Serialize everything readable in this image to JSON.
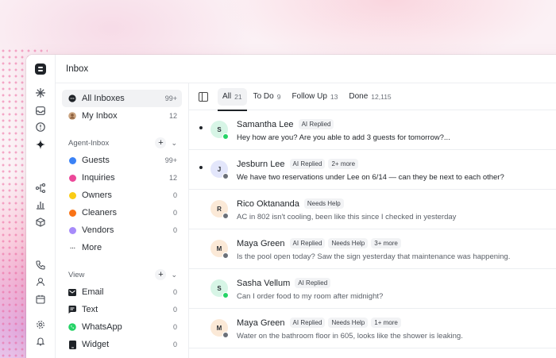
{
  "window": {
    "title": "Inbox"
  },
  "colors": {
    "accent": "#1f2328",
    "whatsapp": "#25d366",
    "email": "#6b7078"
  },
  "rail": {
    "icons": [
      "app-logo-icon",
      "sparkle-outline-icon",
      "inbox-tray-icon",
      "alert-circle-icon",
      "sparkle-filled-icon",
      "workflow-icon",
      "bar-chart-icon",
      "cube-icon",
      "phone-icon",
      "user-icon",
      "calendar-icon",
      "settings-gear-icon",
      "bell-icon"
    ]
  },
  "sidebar": {
    "top": [
      {
        "label": "All Inboxes",
        "count": "99+",
        "icon": "chat-bubble-icon"
      },
      {
        "label": "My Inbox",
        "count": "12",
        "icon": "avatar-icon"
      }
    ],
    "agent_inbox": {
      "title": "Agent-Inbox",
      "items": [
        {
          "label": "Guests",
          "count": "99+",
          "color": "#3b82f6"
        },
        {
          "label": "Inquiries",
          "count": "12",
          "color": "#ec4899"
        },
        {
          "label": "Owners",
          "count": "0",
          "color": "#facc15"
        },
        {
          "label": "Cleaners",
          "count": "0",
          "color": "#f97316"
        },
        {
          "label": "Vendors",
          "count": "0",
          "color": "#a78bfa"
        }
      ],
      "more": "More"
    },
    "view": {
      "title": "View",
      "items": [
        {
          "label": "Email",
          "count": "0",
          "icon": "mail-icon"
        },
        {
          "label": "Text",
          "count": "0",
          "icon": "message-square-icon"
        },
        {
          "label": "WhatsApp",
          "count": "0",
          "icon": "whatsapp-icon"
        },
        {
          "label": "Widget",
          "count": "0",
          "icon": "widget-icon"
        }
      ]
    }
  },
  "tabs": [
    {
      "label": "All",
      "count": "21"
    },
    {
      "label": "To Do",
      "count": "9"
    },
    {
      "label": "Follow Up",
      "count": "13"
    },
    {
      "label": "Done",
      "count": "12,115"
    }
  ],
  "conversations": [
    {
      "initial": "S",
      "name": "Samantha Lee",
      "tags": [
        "AI Replied"
      ],
      "message": "Hey how are you? Are you able to add 3 guests for tomorrow?...",
      "unread": true,
      "avatar_color": "#d7f5e6",
      "channel": "whatsapp"
    },
    {
      "initial": "J",
      "name": "Jesburn Lee",
      "tags": [
        "AI Replied",
        "2+ more"
      ],
      "message": "We have two reservations under Lee on 6/14 — can they be next to each other?",
      "unread": true,
      "avatar_color": "#e3e6fb",
      "channel": "email"
    },
    {
      "initial": "R",
      "name": "Rico Oktananda",
      "tags": [
        "Needs Help"
      ],
      "message": "AC in 802 isn't cooling, been like this since I checked in yesterday",
      "unread": false,
      "avatar_color": "#fbe9d7",
      "channel": "email"
    },
    {
      "initial": "M",
      "name": "Maya Green",
      "tags": [
        "AI Replied",
        "Needs Help",
        "3+ more"
      ],
      "message": "Is the pool open today? Saw the sign yesterday that maintenance was happening.",
      "unread": false,
      "avatar_color": "#fbe9d7",
      "channel": "email"
    },
    {
      "initial": "S",
      "name": "Sasha Vellum",
      "tags": [
        "AI Replied"
      ],
      "message": "Can I order food to my room after midnight?",
      "unread": false,
      "avatar_color": "#d7f5e6",
      "channel": "whatsapp"
    },
    {
      "initial": "M",
      "name": "Maya Green",
      "tags": [
        "AI Replied",
        "Needs Help",
        "1+ more"
      ],
      "message": "Water on the bathroom floor in 605, looks like the shower is leaking.",
      "unread": false,
      "avatar_color": "#fbe9d7",
      "channel": "email"
    }
  ]
}
